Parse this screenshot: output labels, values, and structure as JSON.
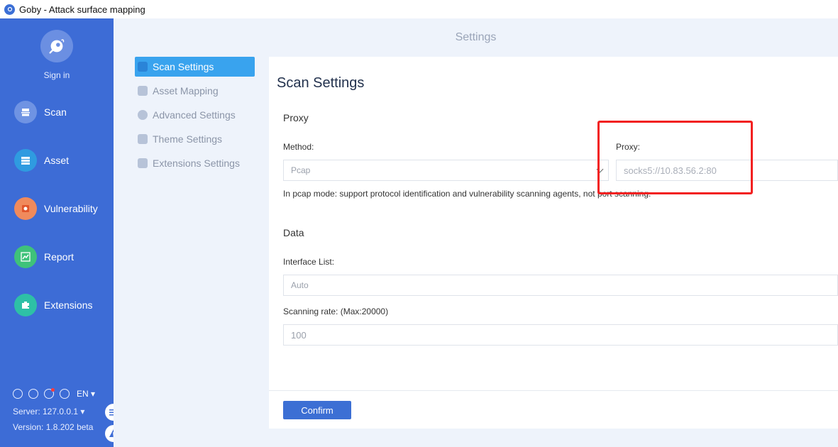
{
  "window": {
    "title": "Goby - Attack surface mapping"
  },
  "sidebar": {
    "signin_label": "Sign in",
    "items": [
      {
        "label": "Scan",
        "icon": "scan-icon",
        "color": "#5b83de"
      },
      {
        "label": "Asset",
        "icon": "asset-icon",
        "color": "#2f9be0"
      },
      {
        "label": "Vulnerability",
        "icon": "vulnerability-icon",
        "color": "#f08a5c"
      },
      {
        "label": "Report",
        "icon": "report-icon",
        "color": "#3fc27a"
      },
      {
        "label": "Extensions",
        "icon": "extensions-icon",
        "color": "#2ec0a6"
      }
    ],
    "language": "EN",
    "server": "Server: 127.0.0.1",
    "version": "Version: 1.8.202 beta"
  },
  "main": {
    "header_title": "Settings",
    "submenu": [
      {
        "label": "Scan Settings",
        "active": true
      },
      {
        "label": "Asset Mapping",
        "active": false
      },
      {
        "label": "Advanced Settings",
        "active": false
      },
      {
        "label": "Theme Settings",
        "active": false
      },
      {
        "label": "Extensions Settings",
        "active": false
      }
    ],
    "panel": {
      "title": "Scan Settings",
      "proxy_section": "Proxy",
      "method_label": "Method:",
      "method_value": "Pcap",
      "proxy_label": "Proxy:",
      "proxy_placeholder": "socks5://10.83.56.2:80",
      "hint": "In pcap mode: support protocol identification and vulnerability scanning agents, not port scanning.",
      "data_section": "Data",
      "interface_label": "Interface List:",
      "interface_value": "Auto",
      "rate_label": "Scanning rate: (Max:20000)",
      "rate_value": "100",
      "confirm_label": "Confirm"
    }
  },
  "colors": {
    "sidebar_bg": "#3d6cd6",
    "active_tab": "#39a3ee",
    "confirm_button": "#3c6fd4",
    "highlight_box": "#f22020"
  }
}
